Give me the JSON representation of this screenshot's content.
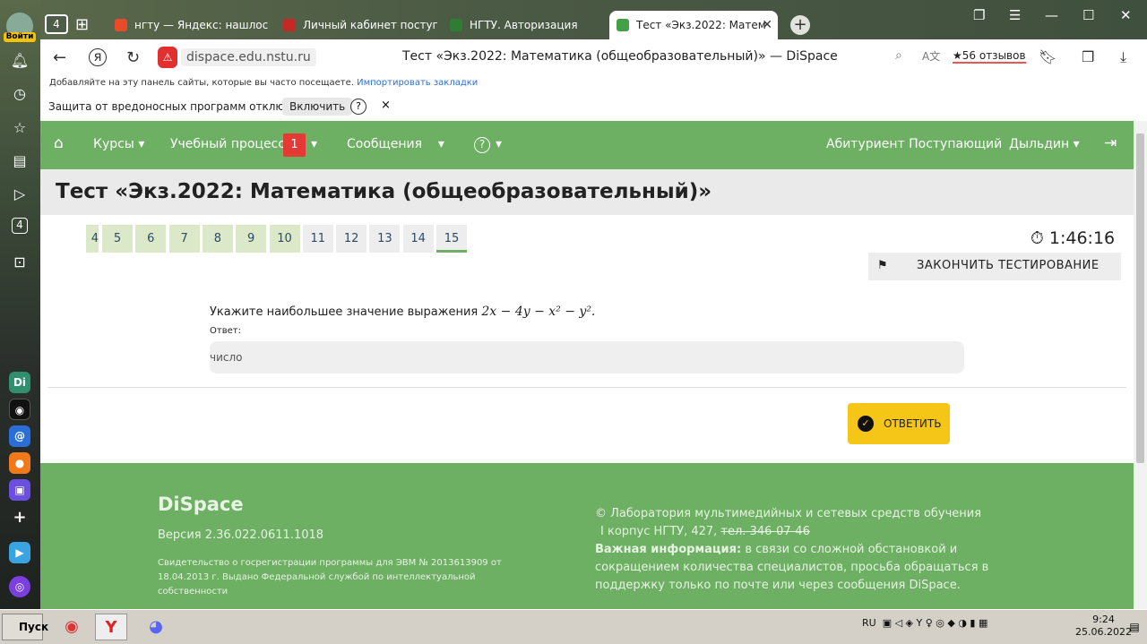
{
  "sidebar": {
    "login_label": "Войти",
    "tab_count": "4",
    "apps": [
      "Di"
    ]
  },
  "tabs": [
    {
      "title": "нгту — Яндекс: нашлось",
      "color": "#e84b2a"
    },
    {
      "title": "Личный кабинет поступа",
      "color": "#c62828"
    },
    {
      "title": "НГТУ. Авторизация",
      "color": "#2e7d32"
    },
    {
      "title": "Тест «Экз.2022: Матем",
      "color": "#43a047"
    }
  ],
  "address": {
    "domain": "dispace.edu.nstu.ru",
    "page_title": "Тест «Экз.2022: Математика (общеобразовательный)» — DiSpace",
    "reviews": "56 отзывов"
  },
  "bookmark_hint": {
    "text": "Добавляйте на эту панель сайты, которые вы часто посещаете.",
    "link": "Импортировать закладки"
  },
  "protection": {
    "text": "Защита от вредоносных программ отключена",
    "button": "Включить",
    "help": "?",
    "close": "×"
  },
  "site_nav": {
    "courses": "Курсы",
    "process": "Учебный процесс",
    "badge": "1",
    "messages": "Сообщения",
    "help": "?",
    "user_role": "Абитуриент Поступающий",
    "user_name": "Дыльдин"
  },
  "test": {
    "title": "Тест «Экз.2022: Математика (общеобразовательный)»",
    "partial_first": "4",
    "questions": [
      {
        "n": "5",
        "state": "done"
      },
      {
        "n": "6",
        "state": "done"
      },
      {
        "n": "7",
        "state": "done"
      },
      {
        "n": "8",
        "state": "done"
      },
      {
        "n": "9",
        "state": "done"
      },
      {
        "n": "10",
        "state": "done"
      },
      {
        "n": "11",
        "state": "todo"
      },
      {
        "n": "12",
        "state": "todo"
      },
      {
        "n": "13",
        "state": "todo"
      },
      {
        "n": "14",
        "state": "todo"
      },
      {
        "n": "15",
        "state": "cur"
      }
    ],
    "timer": "1:46:16",
    "finish_label": "ЗАКОНЧИТЬ ТЕСТИРОВАНИЕ",
    "question_text": "Укажите наибольшее значение выражения",
    "expression": "2x − 4y − x² − y².",
    "answer_label": "Ответ:",
    "answer_placeholder": "число",
    "submit_label": "ОТВЕТИТЬ"
  },
  "footer": {
    "brand": "DiSpace",
    "version": "Версия 2.36.022.0611.1018",
    "cert": "Свидетельство о госрегистрации программы для ЭВМ № 2013613909 от 18.04.2013 г. Выдано Федеральной службой по интеллектуальной собственности",
    "copyright": "© Лаборатория мультимедийных и сетевых средств обучения",
    "address": "I корпус НГТУ, 427,",
    "old_phone": "тел. 346-07-46",
    "important_label": "Важная информация:",
    "important_text": "в связи со сложной обстановкой и сокращением количества специалистов, просьба обращаться в поддержку только по почте или через сообщения DiSpace."
  },
  "taskbar": {
    "start": "Пуск",
    "lang": "RU",
    "time": "9:24",
    "date": "25.06.2022"
  }
}
